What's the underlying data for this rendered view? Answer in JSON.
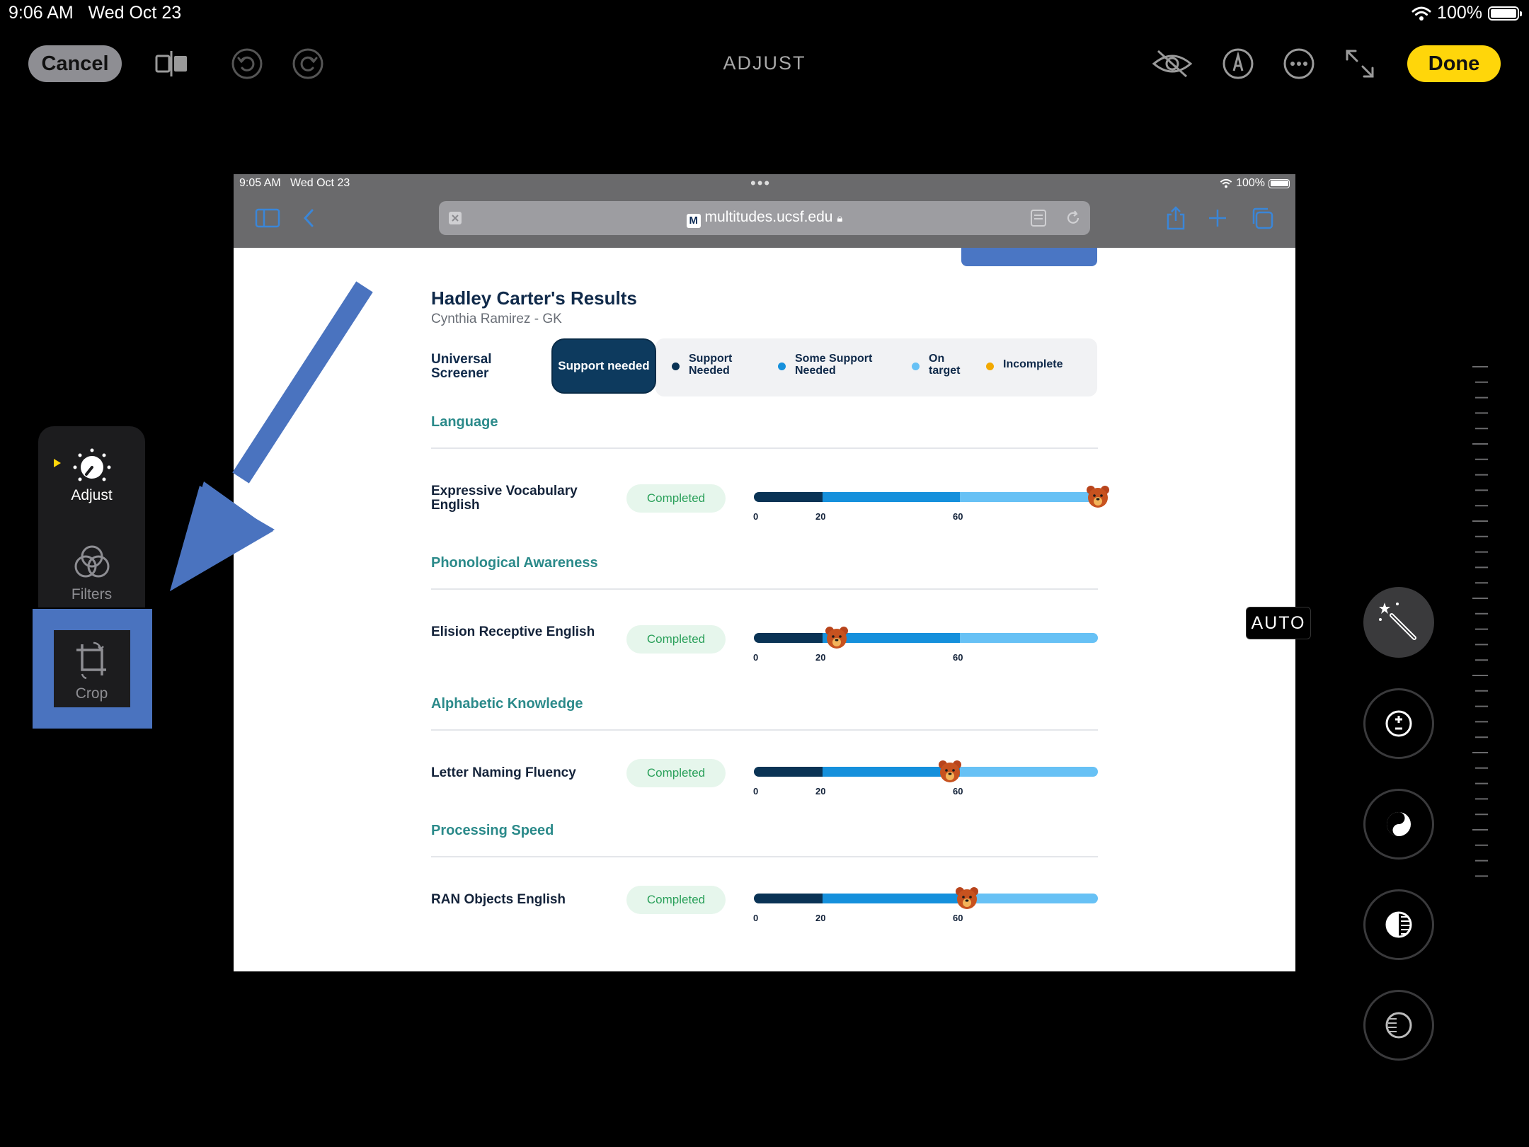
{
  "status_bar": {
    "time": "9:06 AM",
    "date": "Wed Oct 23",
    "battery": "100%"
  },
  "toolbar": {
    "cancel_label": "Cancel",
    "title": "ADJUST",
    "done_label": "Done"
  },
  "screenshot": {
    "status": {
      "time": "9:05 AM",
      "date": "Wed Oct 23",
      "battery": "100%",
      "dots": "•••"
    },
    "url": "multitudes.ucsf.edu",
    "results_title": "Hadley Carter's Results",
    "results_subtitle": "Cynthia Ramirez - GK",
    "universal_screener_label": "Universal Screener",
    "support_pill": "Support needed",
    "legend": [
      {
        "label": "Support Needed",
        "color": "#0a3355"
      },
      {
        "label": "Some Support Needed",
        "color": "#1590dc"
      },
      {
        "label": "On target",
        "color": "#67c1f5"
      },
      {
        "label": "Incomplete",
        "color": "#f2a900"
      }
    ],
    "sections": [
      {
        "heading": "Language",
        "row_label": "Expressive Vocabulary English",
        "status": "Completed",
        "score_percent": 100
      },
      {
        "heading": "Phonological Awareness",
        "row_label": "Elision Receptive English",
        "status": "Completed",
        "score_percent": 24
      },
      {
        "heading": "Alphabetic Knowledge",
        "row_label": "Letter Naming Fluency",
        "status": "Completed",
        "score_percent": 57
      },
      {
        "heading": "Processing Speed",
        "row_label": "RAN Objects English",
        "status": "Completed",
        "score_percent": 62
      }
    ],
    "ticks": [
      "0",
      "20",
      "60"
    ]
  },
  "tool_panel": {
    "adjust_label": "Adjust",
    "filters_label": "Filters",
    "crop_label": "Crop"
  },
  "auto_label": "AUTO",
  "colors": {
    "accent_yellow": "#ffd60a",
    "annotation_blue": "#4a73bf"
  }
}
